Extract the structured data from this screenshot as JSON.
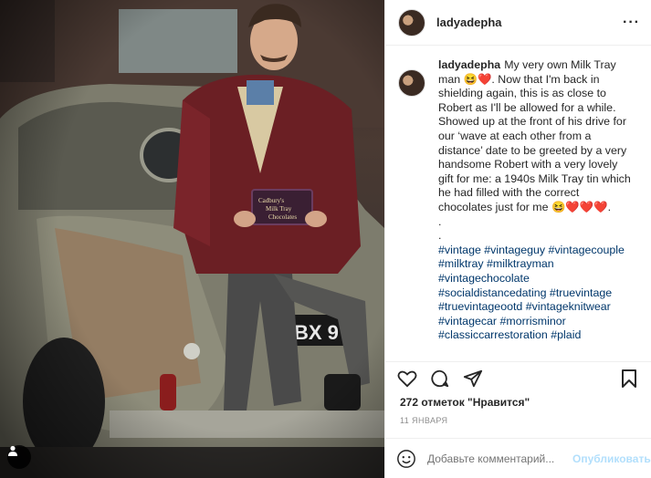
{
  "post": {
    "username": "ladyadepha",
    "more_icon": "ellipsis-icon",
    "caption_user": "ladyadepha",
    "caption_text": "My very own Milk Tray man 😆❤️. Now that I'm back in shielding again, this is as close to Robert as I'll be allowed for a while. Showed up at the front of his drive for our ‘wave at each other from a distance’ date to be greeted by a very handsome Robert with a very lovely gift for me: a 1940s Milk Tray tin which he had filled with the correct chocolates just for me 😆❤️❤️❤️.",
    "dots": [
      ".",
      "."
    ],
    "hashtags": "#vintage #vintageguy #vintagecouple #milktray #milktrayman #vintagechocolate #socialdistancedating #truevintage #truevintageootd #vintageknitwear #vintagecar #morrisminor #classiccarrestoration #plaid",
    "likes": "272 отметок \"Нравится\"",
    "date": "11 ЯНВАРЯ",
    "comment_placeholder": "Добавьте комментарий...",
    "publish_label": "Опубликовать",
    "tin_label": "Cadbury's Milk Tray Chocolates",
    "plate_text": "BX 9"
  },
  "icons": [
    "heart-icon",
    "comment-icon",
    "share-icon",
    "bookmark-icon",
    "smiley-icon",
    "user-tag-icon"
  ],
  "colors": {
    "link": "#00376b",
    "publish": "#b2dffc",
    "muted": "#8e8e8e"
  }
}
